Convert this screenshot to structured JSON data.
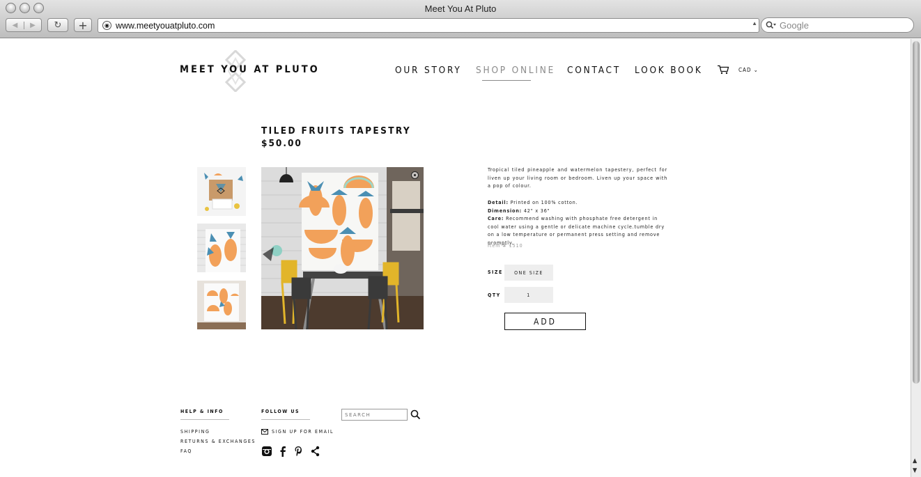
{
  "browser": {
    "window_title": "Meet You At Pluto",
    "url": "www.meetyouatpluto.com",
    "search_placeholder": "Google"
  },
  "site": {
    "logo": "MEET YOU AT PLUTO",
    "nav": {
      "our_story": "OUR STORY",
      "shop_online": "SHOP ONLINE",
      "contact": "CONTACT",
      "look_book": "LOOK BOOK"
    },
    "currency": "CAD"
  },
  "product": {
    "title": "TILED FRUITS TAPESTRY",
    "price": "$50.00",
    "description": "Tropical tiled pineapple and watermelon tapestery, perfect for liven up your living room or bedroom. Liven up your space with a pop of colour.",
    "detail_label": "Detail:",
    "detail_value": "Printed on 100% cotton.",
    "dimension_label": "Dimension:",
    "dimension_value": "42\" x 36\"",
    "care_label": "Care:",
    "care_value": "Recommend washing with phosphate free detergent in cool water using a gentle or delicate machine cycle.tumble dry on a low temperature or permanent press setting and remove promptly.",
    "item_number": "Item # 1510",
    "size_label": "SIZE",
    "size_value": "ONE SIZE",
    "qty_label": "QTY",
    "qty_value": "1",
    "add_label": "ADD"
  },
  "footer": {
    "help_heading": "HELP & INFO",
    "links": [
      "SHIPPING",
      "RETURNS & EXCHANGES",
      "FAQ"
    ],
    "follow_heading": "FOLLOW US",
    "signup": "SIGN UP FOR EMAIL",
    "search_placeholder": "SEARCH"
  },
  "colors": {
    "accent_gray": "#8a8a8a",
    "melon_orange": "#f2a15a",
    "pineapple_blue": "#4b8fb3"
  }
}
